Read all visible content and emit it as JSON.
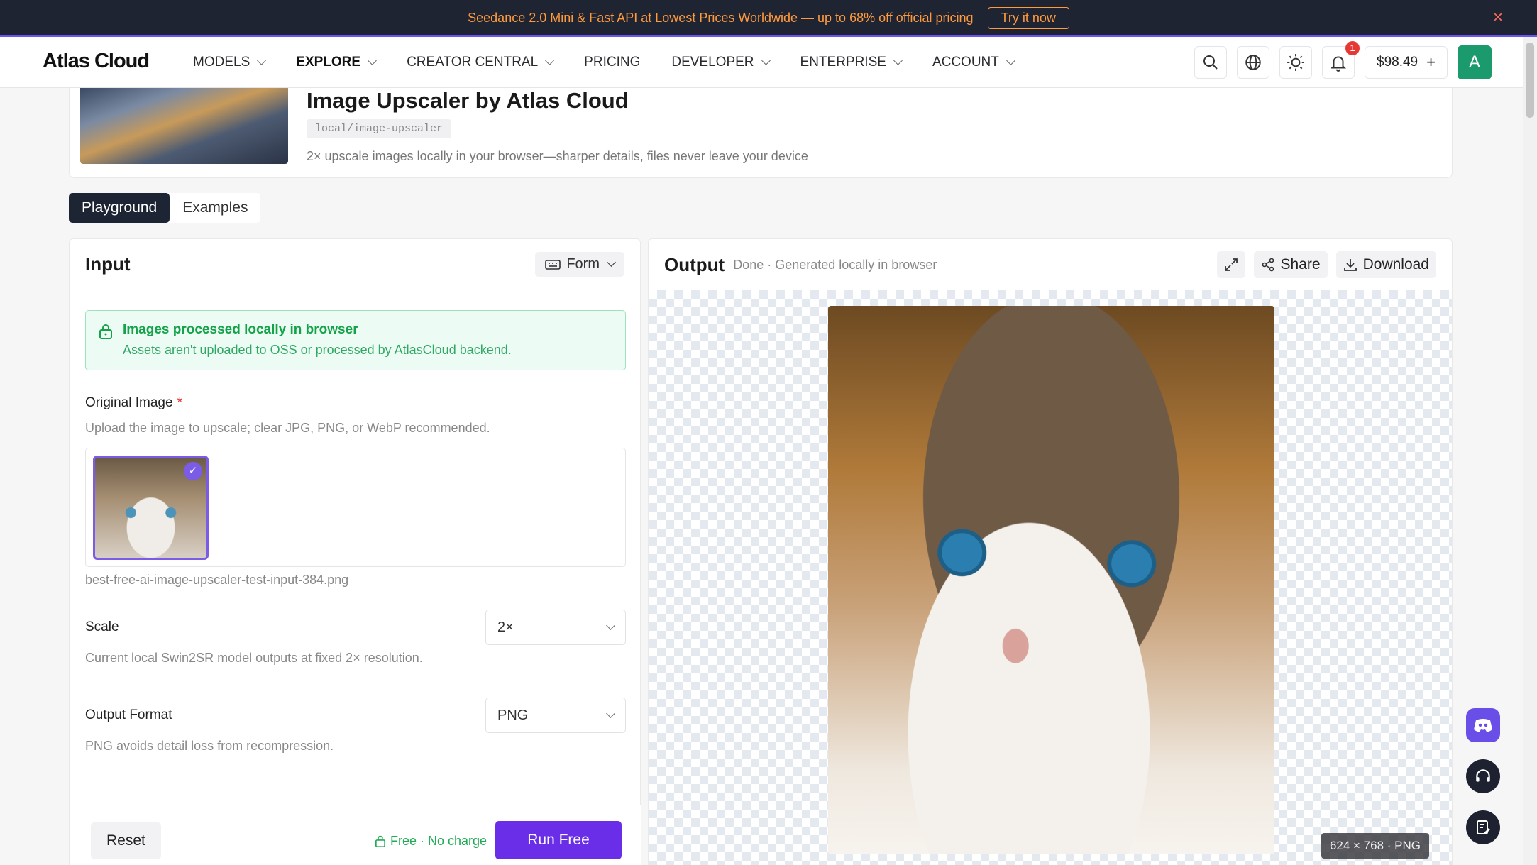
{
  "banner": {
    "text": "Seedance 2.0 Mini & Fast API at Lowest Prices Worldwide — up to 68% off official pricing",
    "cta": "Try it now",
    "close": "×"
  },
  "nav": {
    "logo": "Atlas Cloud",
    "items": [
      {
        "label": "MODELS",
        "dropdown": true
      },
      {
        "label": "EXPLORE",
        "dropdown": true,
        "active": true
      },
      {
        "label": "CREATOR CENTRAL",
        "dropdown": true
      },
      {
        "label": "PRICING",
        "dropdown": false
      },
      {
        "label": "DEVELOPER",
        "dropdown": true
      },
      {
        "label": "ENTERPRISE",
        "dropdown": true
      },
      {
        "label": "ACCOUNT",
        "dropdown": true
      }
    ],
    "notification_count": "1",
    "balance": "$98.49",
    "balance_add": "+",
    "avatar": "A"
  },
  "model": {
    "title": "Image Upscaler by Atlas Cloud",
    "path": "local/image-upscaler",
    "description": "2× upscale images locally in your browser—sharper details, files never leave your device"
  },
  "tabs": [
    {
      "label": "Playground",
      "active": true
    },
    {
      "label": "Examples",
      "active": false
    }
  ],
  "input": {
    "title": "Input",
    "mode": "Form",
    "local_title": "Images processed locally in browser",
    "local_sub": "Assets aren't uploaded to OSS or processed by AtlasCloud backend.",
    "image_label": "Original Image",
    "required_mark": "*",
    "image_hint": "Upload the image to upscale; clear JPG, PNG, or WebP recommended.",
    "filename": "best-free-ai-image-upscaler-test-input-384.png",
    "scale_label": "Scale",
    "scale_value": "2×",
    "scale_hint": "Current local Swin2SR model outputs at fixed 2× resolution.",
    "format_label": "Output Format",
    "format_value": "PNG",
    "format_hint": "PNG avoids detail loss from recompression.",
    "reset": "Reset",
    "free_note": "Free · No charge",
    "run": "Run Free"
  },
  "output": {
    "title": "Output",
    "status": "Done · Generated locally in browser",
    "share": "Share",
    "download": "Download",
    "dims": "624 × 768 · PNG"
  },
  "colors": {
    "accent": "#6a2ee8",
    "banner_bg": "#1f2433",
    "banner_text": "#ff9a3d",
    "success": "#14a34a",
    "discord": "#6a4ee8"
  }
}
